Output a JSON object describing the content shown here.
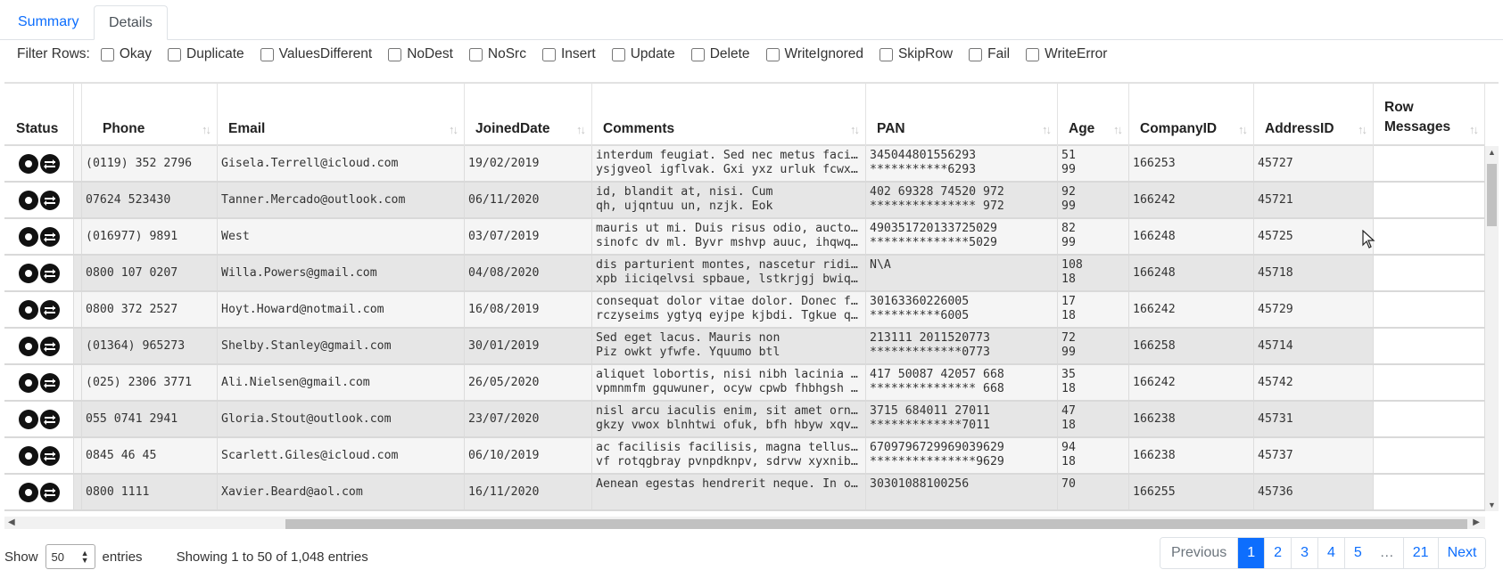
{
  "tabs": [
    {
      "label": "Summary",
      "active": false
    },
    {
      "label": "Details",
      "active": true
    }
  ],
  "filters": {
    "label": "Filter Rows:",
    "options": [
      "Okay",
      "Duplicate",
      "ValuesDifferent",
      "NoDest",
      "NoSrc",
      "Insert",
      "Update",
      "Delete",
      "WriteIgnored",
      "SkipRow",
      "Fail",
      "WriteError"
    ]
  },
  "columns": {
    "status": "Status",
    "phone": "Phone",
    "email": "Email",
    "joined": "JoinedDate",
    "comments": "Comments",
    "pan": "PAN",
    "age": "Age",
    "company": "CompanyID",
    "address": "AddressID",
    "row_messages": "Row Messages"
  },
  "rows": [
    {
      "phone": "(0119) 352 2796",
      "email": "Gisela.Terrell@icloud.com",
      "joined": "19/02/2019",
      "comments": [
        "interdum feugiat. Sed nec metus facilisis",
        "ysjgveol igflvak. Gxi yxz urluk fcwxqhe"
      ],
      "pan": [
        "345044801556293",
        "***********6293"
      ],
      "age": [
        "51",
        "99"
      ],
      "company": "166253",
      "address": "45727"
    },
    {
      "phone": "07624 523430",
      "email": "Tanner.Mercado@outlook.com",
      "joined": "06/11/2020",
      "comments": [
        "id, blandit at, nisi. Cum",
        "qh, ujqntuu un, nzjk. Eok"
      ],
      "pan": [
        "402 69328 74520 972",
        "*************** 972"
      ],
      "age": [
        "92",
        "99"
      ],
      "company": "166242",
      "address": "45721"
    },
    {
      "phone": "(016977) 9891",
      "email": "West",
      "joined": "03/07/2019",
      "comments": [
        "mauris ut mi. Duis risus odio, auctor vitae",
        "sinofc dv ml. Byvr mshvp auuc, ihqwqx rfrdi"
      ],
      "pan": [
        "490351720133725029",
        "**************5029"
      ],
      "age": [
        "82",
        "99"
      ],
      "company": "166248",
      "address": "45725"
    },
    {
      "phone": "0800 107 0207",
      "email": "Willa.Powers@gmail.com",
      "joined": "04/08/2020",
      "comments": [
        "dis parturient montes, nascetur ridiculus",
        "xpb iiciqelvsi spbaue, lstkrjgj bwiqjvfoc"
      ],
      "pan": [
        "N\\A",
        ""
      ],
      "age": [
        "108",
        "18"
      ],
      "company": "166248",
      "address": "45718"
    },
    {
      "phone": "0800 372 2527",
      "email": "Hoyt.Howard@notmail.com",
      "joined": "16/08/2019",
      "comments": [
        "consequat dolor vitae dolor. Donec fringilla",
        "rczyseims ygtyq eyjpe kjbdi. Tgkue qhwqtldh"
      ],
      "pan": [
        "30163360226005",
        "**********6005"
      ],
      "age": [
        "17",
        "18"
      ],
      "company": "166242",
      "address": "45729"
    },
    {
      "phone": "(01364) 965273",
      "email": "Shelby.Stanley@gmail.com",
      "joined": "30/01/2019",
      "comments": [
        "Sed eget lacus. Mauris non",
        "Piz owkt yfwfe. Yquumo btl"
      ],
      "pan": [
        "213111 2011520773",
        "*************0773"
      ],
      "age": [
        "72",
        "99"
      ],
      "company": "166258",
      "address": "45714"
    },
    {
      "phone": "(025) 2306 3771",
      "email": "Ali.Nielsen@gmail.com",
      "joined": "26/05/2020",
      "comments": [
        "aliquet lobortis, nisi nibh lacinia orci",
        "vpmnmfm gquwuner, ocyw cpwb fhbhgsh ukbl"
      ],
      "pan": [
        "417 50087 42057 668",
        "*************** 668"
      ],
      "age": [
        "35",
        "18"
      ],
      "company": "166242",
      "address": "45742"
    },
    {
      "phone": "055 0741 2941",
      "email": "Gloria.Stout@outlook.com",
      "joined": "23/07/2020",
      "comments": [
        "nisl arcu iaculis enim, sit amet ornare",
        "gkzy vwox blnhtwi ofuk, bfh hbyw xqvhkw"
      ],
      "pan": [
        "3715 684011 27011",
        "*************7011"
      ],
      "age": [
        "47",
        "18"
      ],
      "company": "166238",
      "address": "45731"
    },
    {
      "phone": "0845 46 45",
      "email": "Scarlett.Giles@icloud.com",
      "joined": "06/10/2019",
      "comments": [
        "ac facilisis facilisis, magna tellus faucibus",
        "vf rotqgbray pvnpdknpv, sdrvw xyxnib zbvwqhu"
      ],
      "pan": [
        "6709796729969039629",
        "***************9629"
      ],
      "age": [
        "94",
        "18"
      ],
      "company": "166238",
      "address": "45737"
    },
    {
      "phone": "0800 1111",
      "email": "Xavier.Beard@aol.com",
      "joined": "16/11/2020",
      "comments": [
        "Aenean egestas hendrerit neque. In ornare",
        ""
      ],
      "pan": [
        "30301088100256",
        ""
      ],
      "age": [
        "70",
        ""
      ],
      "company": "166255",
      "address": "45736"
    }
  ],
  "footer": {
    "show_label": "Show",
    "page_size": "50",
    "entries_label": "entries",
    "info": "Showing 1 to 50 of 1,048 entries"
  },
  "pagination": {
    "previous": "Previous",
    "pages": [
      "1",
      "2",
      "3",
      "4",
      "5"
    ],
    "ellipsis": "…",
    "last": "21",
    "next": "Next",
    "active_page": "1"
  },
  "icons": {
    "status_icons": [
      "record-icon",
      "swap-icon"
    ]
  },
  "colors": {
    "accent": "#0d6efd"
  }
}
